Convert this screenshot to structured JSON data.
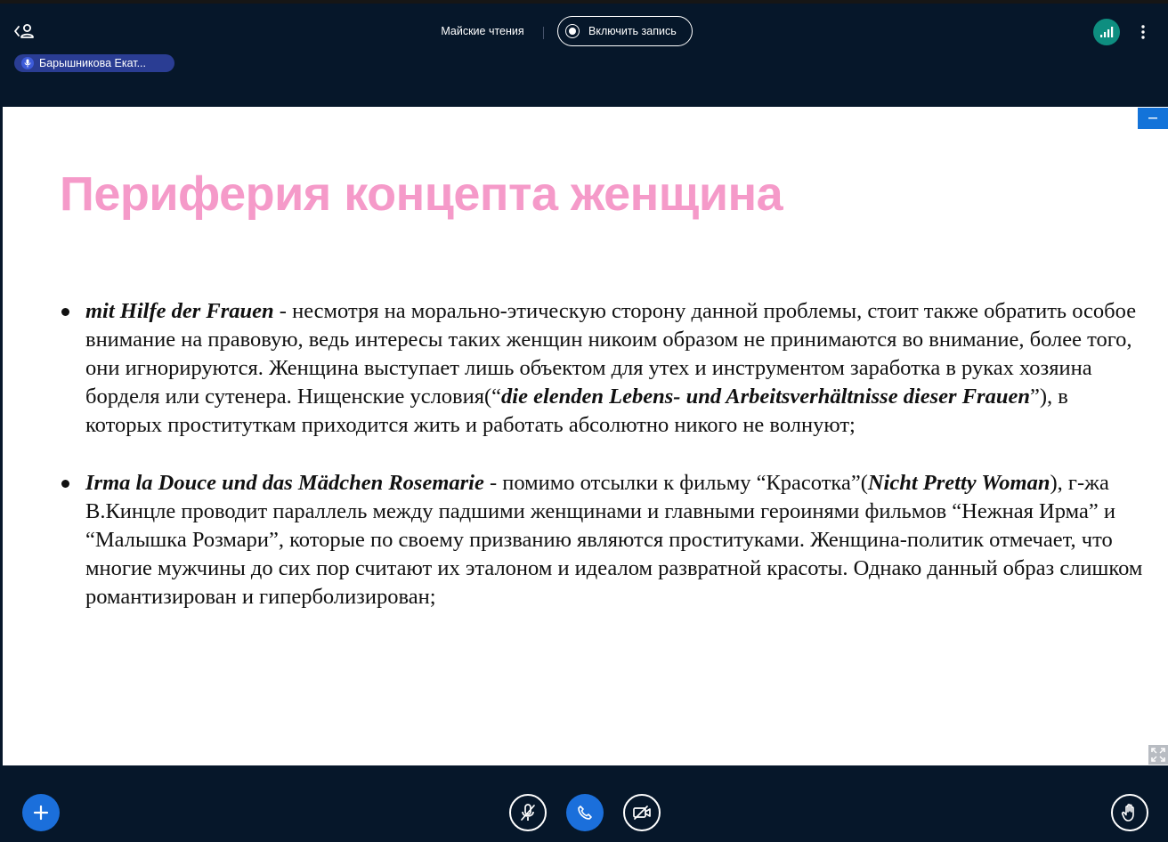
{
  "header": {
    "meeting_title": "Майские чтения",
    "record_label": "Включить запись",
    "presenter_name": "Барышникова Екат..."
  },
  "slide": {
    "title": "Периферия концепта женщина",
    "bullets": [
      {
        "lead": "mit Hilfe der Frauen",
        "text1": " - несмотря на морально-этическую сторону данной проблемы, стоит также обратить особое внимание на правовую, ведь интересы таких женщин никоим образом не принимаются во внимание, более того, они игнорируются. Женщина выступает лишь объектом для утех и инструментом заработка в руках хозяина борделя или сутенера. Нищенские условия(“",
        "emph1": "die elenden Lebens- und Arbeitsverhältnisse dieser Frauen",
        "text2": "”), в которых проституткам приходится жить и работать абсолютно никого не волнуют;"
      },
      {
        "lead": "Irma la Douce und das Mädchen Rosemarie",
        "text1": " - помимо отсылки к фильму “Красотка”(",
        "emph1": "Nicht Pretty Woman",
        "text2": "), г-жа В.Кинцле проводит параллель между падшими женщинами и главными героинями фильмов “Нежная Ирма” и “Малышка Розмари”, которые по своему призванию являются проституками. Женщина-политик отмечает, что многие мужчины до сих пор считают их эталоном и идеалом развратной красоты. Однако данный образ слишком романтизирован и гиперболизирован;"
      }
    ]
  },
  "colors": {
    "background": "#06172a",
    "title_pink": "#f59ac9",
    "accent_blue": "#1b6fdb",
    "presenter_pill": "#2a3d93",
    "connection_green": "#0e8e80"
  },
  "icons": {
    "back": "user-back-icon",
    "mic": "mic-icon",
    "connection": "signal-bars-icon",
    "more": "more-vertical-icon",
    "minimize": "minus-icon",
    "fullscreen": "expand-icon",
    "actions": "plus-icon",
    "mute": "mic-off-icon",
    "audio": "phone-icon",
    "video": "video-off-icon",
    "raise_hand": "hand-icon"
  }
}
